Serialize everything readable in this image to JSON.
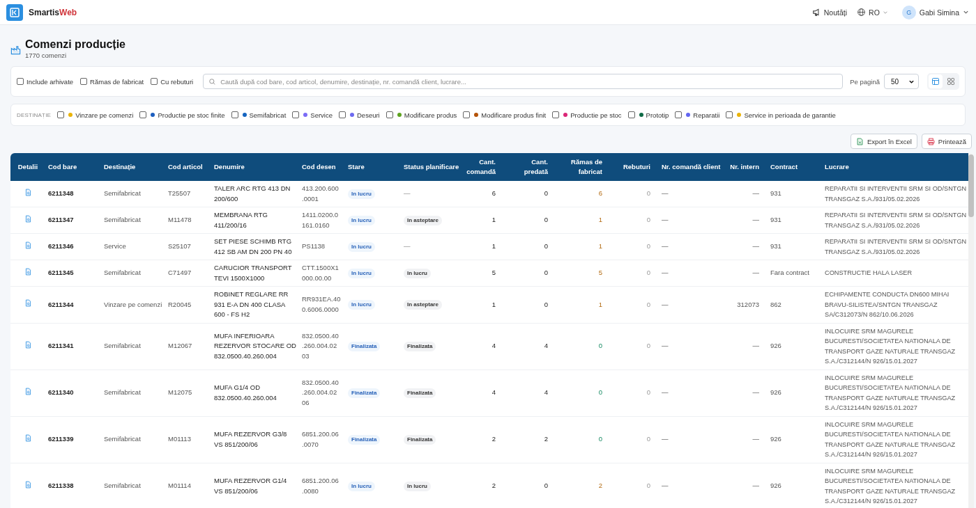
{
  "brand": {
    "part_1": "Smartis",
    "part_2": "Web"
  },
  "topbar": {
    "news": "Noutăți",
    "language": "RO",
    "user": {
      "initial": "G",
      "name": "Gabi Simina"
    }
  },
  "page": {
    "title": "Comenzi producție",
    "subtitle": "1770 comenzi"
  },
  "filters": {
    "checkboxes": [
      {
        "label": "Include arhivate",
        "checked": false
      },
      {
        "label": "Rămas de fabricat",
        "checked": false
      },
      {
        "label": "Cu rebuturi",
        "checked": false
      }
    ],
    "search": {
      "placeholder": "Caută după cod bare, cod articol, denumire, destinație, nr. comandă client, lucrare..."
    },
    "per_page": {
      "label": "Pe pagină",
      "value": "50"
    },
    "views": [
      {
        "kind": "table",
        "selected": true
      },
      {
        "kind": "grid",
        "selected": false
      }
    ]
  },
  "destinations": {
    "label": "DESTINAȚIE",
    "items": [
      {
        "label": "Vinzare pe comenzi",
        "color": "#eab308",
        "checked": false
      },
      {
        "label": "Productie pe stoc finite",
        "color": "#1d5fbf",
        "checked": false
      },
      {
        "label": "Semifabricat",
        "color": "#1565c0",
        "checked": false
      },
      {
        "label": "Service",
        "color": "#7b6cf6",
        "checked": false
      },
      {
        "label": "Deseuri",
        "color": "#6d6af0",
        "checked": false
      },
      {
        "label": "Modificare produs",
        "color": "#5ea31f",
        "checked": false
      },
      {
        "label": "Modificare produs finit",
        "color": "#b45309",
        "checked": false
      },
      {
        "label": "Productie pe stoc",
        "color": "#db2777",
        "checked": false
      },
      {
        "label": "Prototip",
        "color": "#0f6b46",
        "checked": false
      },
      {
        "label": "Reparatii",
        "color": "#6366f1",
        "checked": false
      },
      {
        "label": "Service in perioada de garantie",
        "color": "#eab308",
        "checked": false
      }
    ]
  },
  "actions": [
    {
      "kind": "excel",
      "label": "Export în Excel"
    },
    {
      "kind": "print",
      "label": "Printează"
    }
  ],
  "table": {
    "columns": [
      "Detalii",
      "Cod bare",
      "Destinație",
      "Cod articol",
      "Denumire",
      "Cod desen",
      "Stare",
      "Status planificare",
      "Cant. comandă",
      "Cant. predată",
      "Rămas de fabricat",
      "Rebuturi",
      "Nr. comandă client",
      "Nr. intern",
      "Contract",
      "Lucrare"
    ],
    "rows": [
      {
        "cod_bare": "6211348",
        "destinatie": "Semifabricat",
        "cod_articol": "T25507",
        "denumire": "TALER ARC RTG 413 DN 200/600",
        "cod_desen": "413.200.600 .0001",
        "stare": "In lucru",
        "status_planificare": "—",
        "planned": false,
        "cant_comanda": "6",
        "cant_predata": "0",
        "ramas": "6",
        "complete": false,
        "rebuturi": "0",
        "nr_comanda_client": "—",
        "nr_intern": "—",
        "contract": "931",
        "lucrare": "REPARATII SI INTERVENTII SRM SI OD/SNTGN TRANSGAZ S.A./931/05.02.2026"
      },
      {
        "cod_bare": "6211347",
        "destinatie": "Semifabricat",
        "cod_articol": "M11478",
        "denumire": "MEMBRANA RTG 411/200/16",
        "cod_desen": "1411.0200.0 161.0160",
        "stare": "In lucru",
        "status_planificare": "In asteptare",
        "planned": true,
        "cant_comanda": "1",
        "cant_predata": "0",
        "ramas": "1",
        "complete": false,
        "rebuturi": "0",
        "nr_comanda_client": "—",
        "nr_intern": "—",
        "contract": "931",
        "lucrare": "REPARATII SI INTERVENTII SRM SI OD/SNTGN TRANSGAZ S.A./931/05.02.2026"
      },
      {
        "cod_bare": "6211346",
        "destinatie": "Service",
        "cod_articol": "S25107",
        "denumire": "SET PIESE SCHIMB RTG 412 SB AM DN 200 PN 40",
        "cod_desen": "PS1138",
        "stare": "In lucru",
        "status_planificare": "—",
        "planned": false,
        "cant_comanda": "1",
        "cant_predata": "0",
        "ramas": "1",
        "complete": false,
        "rebuturi": "0",
        "nr_comanda_client": "—",
        "nr_intern": "—",
        "contract": "931",
        "lucrare": "REPARATII SI INTERVENTII SRM SI OD/SNTGN TRANSGAZ S.A./931/05.02.2026"
      },
      {
        "cod_bare": "6211345",
        "destinatie": "Semifabricat",
        "cod_articol": "C71497",
        "denumire": "CARUCIOR TRANSPORT TEVI 1500X1000",
        "cod_desen": "CTT.1500X1 000.00.00",
        "stare": "In lucru",
        "status_planificare": "In lucru",
        "planned": true,
        "cant_comanda": "5",
        "cant_predata": "0",
        "ramas": "5",
        "complete": false,
        "rebuturi": "0",
        "nr_comanda_client": "—",
        "nr_intern": "—",
        "contract": "Fara contract",
        "lucrare": "CONSTRUCTIE HALA LASER"
      },
      {
        "cod_bare": "6211344",
        "destinatie": "Vinzare pe comenzi",
        "cod_articol": "R20045",
        "denumire": "ROBINET REGLARE RR 931 E-A DN 400 CLASA 600 - FS H2",
        "cod_desen": "RR931EA.40 0.6006.0000",
        "stare": "In lucru",
        "status_planificare": "In asteptare",
        "planned": true,
        "cant_comanda": "1",
        "cant_predata": "0",
        "ramas": "1",
        "complete": false,
        "rebuturi": "0",
        "nr_comanda_client": "—",
        "nr_intern": "312073",
        "contract": "862",
        "lucrare": "ECHIPAMENTE CONDUCTA DN600 MIHAI BRAVU-SILISTEA/SNTGN TRANSGAZ SA/C312073/N 862/10.06.2026"
      },
      {
        "cod_bare": "6211341",
        "destinatie": "Semifabricat",
        "cod_articol": "M12067",
        "denumire": "MUFA INFERIOARA REZERVOR STOCARE OD 832.0500.40.260.004",
        "cod_desen": "832.0500.40 .260.004.02 03",
        "stare": "Finalizata",
        "status_planificare": "Finalizata",
        "planned": true,
        "cant_comanda": "4",
        "cant_predata": "4",
        "ramas": "0",
        "complete": true,
        "rebuturi": "0",
        "nr_comanda_client": "—",
        "nr_intern": "—",
        "contract": "926",
        "lucrare": "INLOCUIRE SRM MAGURELE BUCURESTI/SOCIETATEA NATIONALA DE TRANSPORT GAZE NATURALE TRANSGAZ S.A./C312144/N 926/15.01.2027"
      },
      {
        "cod_bare": "6211340",
        "destinatie": "Semifabricat",
        "cod_articol": "M12075",
        "denumire": "MUFA G1/4 OD 832.0500.40.260.004",
        "cod_desen": "832.0500.40 .260.004.02 06",
        "stare": "Finalizata",
        "status_planificare": "Finalizata",
        "planned": true,
        "cant_comanda": "4",
        "cant_predata": "4",
        "ramas": "0",
        "complete": true,
        "rebuturi": "0",
        "nr_comanda_client": "—",
        "nr_intern": "—",
        "contract": "926",
        "lucrare": "INLOCUIRE SRM MAGURELE BUCURESTI/SOCIETATEA NATIONALA DE TRANSPORT GAZE NATURALE TRANSGAZ S.A./C312144/N 926/15.01.2027"
      },
      {
        "cod_bare": "6211339",
        "destinatie": "Semifabricat",
        "cod_articol": "M01113",
        "denumire": "MUFA REZERVOR G3/8 VS 851/200/06",
        "cod_desen": "6851.200.06 .0070",
        "stare": "Finalizata",
        "status_planificare": "Finalizata",
        "planned": true,
        "cant_comanda": "2",
        "cant_predata": "2",
        "ramas": "0",
        "complete": true,
        "rebuturi": "0",
        "nr_comanda_client": "—",
        "nr_intern": "—",
        "contract": "926",
        "lucrare": "INLOCUIRE SRM MAGURELE BUCURESTI/SOCIETATEA NATIONALA DE TRANSPORT GAZE NATURALE TRANSGAZ S.A./C312144/N 926/15.01.2027"
      },
      {
        "cod_bare": "6211338",
        "destinatie": "Semifabricat",
        "cod_articol": "M01114",
        "denumire": "MUFA REZERVOR G1/4 VS 851/200/06",
        "cod_desen": "6851.200.06 .0080",
        "stare": "In lucru",
        "status_planificare": "In lucru",
        "planned": true,
        "cant_comanda": "2",
        "cant_predata": "0",
        "ramas": "2",
        "complete": false,
        "rebuturi": "0",
        "nr_comanda_client": "—",
        "nr_intern": "—",
        "contract": "926",
        "lucrare": "INLOCUIRE SRM MAGURELE BUCURESTI/SOCIETATEA NATIONALA DE TRANSPORT GAZE NATURALE TRANSGAZ S.A./C312144/N 926/15.01.2027"
      }
    ]
  }
}
